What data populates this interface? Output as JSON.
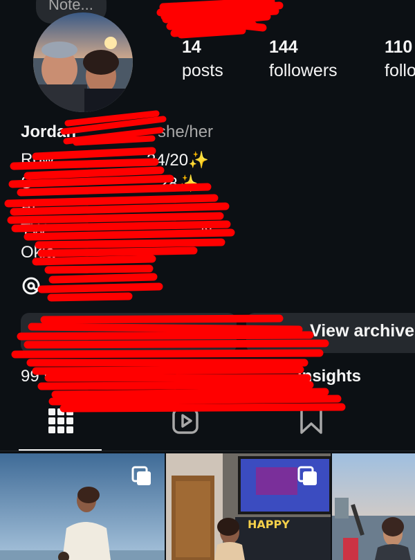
{
  "note": {
    "text": "Note..."
  },
  "stats": [
    {
      "value": "14",
      "label": "posts"
    },
    {
      "value": "144",
      "label": "followers"
    },
    {
      "value": "110",
      "label": "follo"
    }
  ],
  "bio": {
    "name": "Jordan",
    "pronouns": "she/her",
    "line1_left": "Row",
    "line1_right": "24/20✨",
    "line2_left": "S",
    "line2_right": "28✨",
    "line3_left": "Ar",
    "line4_left": "TW",
    "line4_right": "N",
    "line5_left": "Okla"
  },
  "buttons": {
    "view_archive": "View archive",
    "profile_views": "99 views",
    "insights": "insights"
  },
  "tabs": [
    {
      "name": "grid",
      "icon": "grid-icon",
      "active": true
    },
    {
      "name": "reels",
      "icon": "reels-icon",
      "active": false
    },
    {
      "name": "tagged",
      "icon": "tagged-icon",
      "active": false
    }
  ],
  "colors": {
    "background": "#0c1014",
    "button": "#25292e",
    "text": "#f5f5f5",
    "muted": "#a8a8a8",
    "redaction": "#ff0000"
  }
}
